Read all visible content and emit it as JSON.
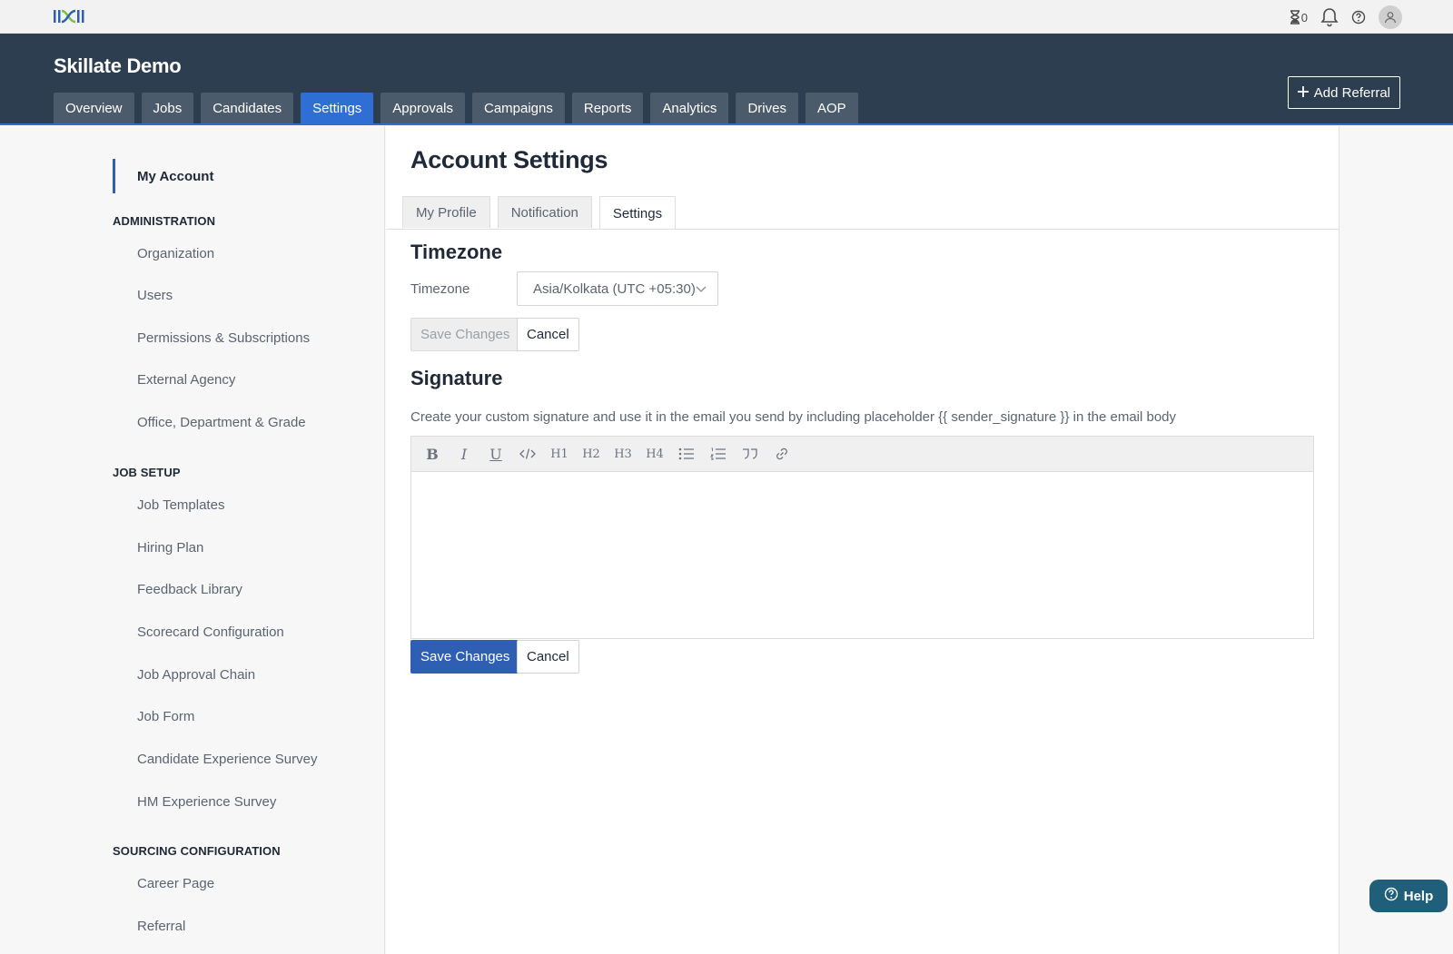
{
  "topbar": {
    "timer_count": "0"
  },
  "header": {
    "app_title": "Skillate Demo",
    "add_referral_label": "Add Referral",
    "nav_tabs": [
      {
        "label": "Overview"
      },
      {
        "label": "Jobs"
      },
      {
        "label": "Candidates"
      },
      {
        "label": "Settings",
        "active": true
      },
      {
        "label": "Approvals"
      },
      {
        "label": "Campaigns"
      },
      {
        "label": "Reports"
      },
      {
        "label": "Analytics"
      },
      {
        "label": "Drives"
      },
      {
        "label": "AOP"
      }
    ]
  },
  "sidebar": {
    "active_item": "My Account",
    "sections": [
      {
        "title": "ADMINISTRATION",
        "items": [
          "Organization",
          "Users",
          "Permissions & Subscriptions",
          "External Agency",
          "Office, Department & Grade"
        ]
      },
      {
        "title": "JOB SETUP",
        "items": [
          "Job Templates",
          "Hiring Plan",
          "Feedback Library",
          "Scorecard Configuration",
          "Job Approval Chain",
          "Job Form",
          "Candidate Experience Survey",
          "HM Experience Survey"
        ]
      },
      {
        "title": "SOURCING CONFIGURATION",
        "items": [
          "Career Page",
          "Referral"
        ]
      }
    ]
  },
  "main": {
    "page_title": "Account Settings",
    "tabs": [
      {
        "label": "My Profile"
      },
      {
        "label": "Notification"
      },
      {
        "label": "Settings",
        "active": true
      }
    ],
    "timezone": {
      "section_title": "Timezone",
      "field_label": "Timezone",
      "selected_value": "Asia/Kolkata (UTC +05:30)",
      "save_label": "Save Changes",
      "cancel_label": "Cancel"
    },
    "signature": {
      "section_title": "Signature",
      "description": "Create your custom signature and use it in the email you send by including placeholder {{ sender_signature }} in the email body",
      "toolbar": {
        "bold": "B",
        "italic": "I",
        "underline": "U",
        "h1": "H1",
        "h2": "H2",
        "h3": "H3",
        "h4": "H4"
      },
      "editor_content": "",
      "save_label": "Save Changes",
      "cancel_label": "Cancel"
    }
  },
  "help": {
    "label": "Help"
  },
  "colors": {
    "header_bg": "#2c3e50",
    "accent": "#2f6fd4",
    "primary_button": "#2f5fb3",
    "help_button": "#1f5f7a"
  }
}
